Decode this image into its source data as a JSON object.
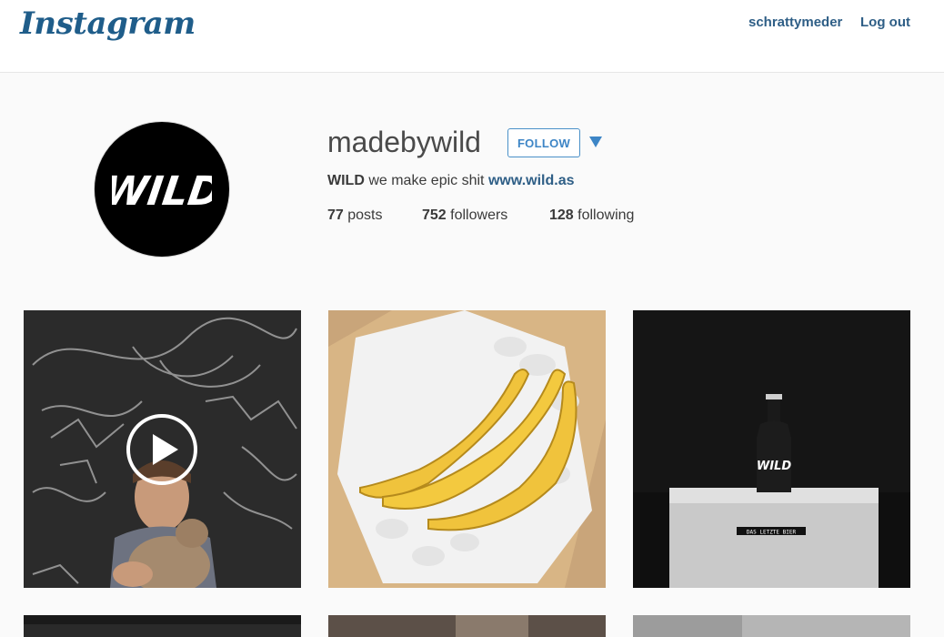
{
  "header": {
    "logo_text": "Instagram",
    "user_link": "schrattymeder",
    "logout_link": "Log out"
  },
  "profile": {
    "avatar_text": "WILD",
    "username": "madebywild",
    "follow_label": "FOLLOW",
    "bio_name": "WILD",
    "bio_text": "we make epic shit",
    "bio_link": "www.wild.as",
    "posts_count": "77",
    "posts_label": "posts",
    "followers_count": "752",
    "followers_label": "followers",
    "following_count": "128",
    "following_label": "following"
  },
  "grid": {
    "bottle_label": "DAS LETZTE BIER"
  },
  "colors": {
    "link": "#2e5e86",
    "follow_accent": "#3d85c6",
    "background": "#fafafa"
  }
}
